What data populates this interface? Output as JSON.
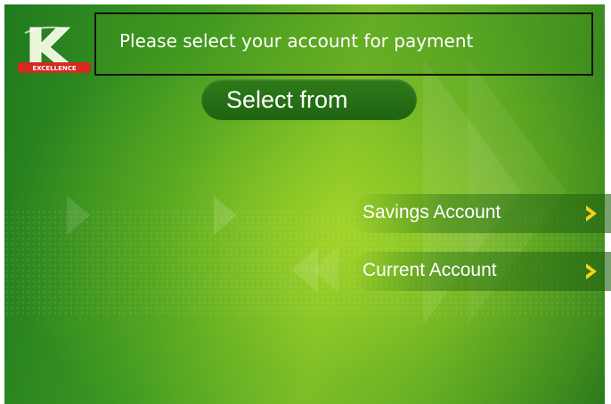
{
  "header": {
    "instruction": "Please select your account for payment"
  },
  "prompt": {
    "title": "Select from"
  },
  "accounts": {
    "options": [
      {
        "label": "Savings Account",
        "icon": "chevron-right-icon"
      },
      {
        "label": "Current Account",
        "icon": "chevron-right-icon"
      }
    ]
  },
  "logo": {
    "icon": "bank-logo-icon",
    "text": "EXCELLENCE"
  },
  "colors": {
    "accent_arrow": "#f2d21b",
    "background_dark": "#1f7a1e",
    "background_light": "#74b92a",
    "logo_red": "#d42a1f"
  }
}
